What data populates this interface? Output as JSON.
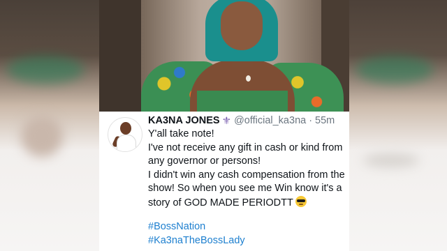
{
  "tweet": {
    "name": "KA3NA JONES",
    "verified_icon": "fleur-de-lis-icon",
    "handle": "@official_ka3na",
    "separator": "·",
    "time": "55m",
    "lines": [
      "Y'all take note!",
      "I've not receive any gift in cash or kind from",
      "any governor or persons!",
      "I didn't win any cash compensation from the",
      "show! So when you see me Win know it's a",
      "story of GOD MADE PERIODTT"
    ],
    "emoji": "smiling-face-with-sunglasses",
    "hashtags": [
      "#BossNation",
      "#Ka3naTheBossLady"
    ]
  },
  "colors": {
    "hashtag": "#1d7fcf",
    "name": "#0f1419",
    "meta": "#6b7680",
    "hair": "#1a8f8d"
  }
}
